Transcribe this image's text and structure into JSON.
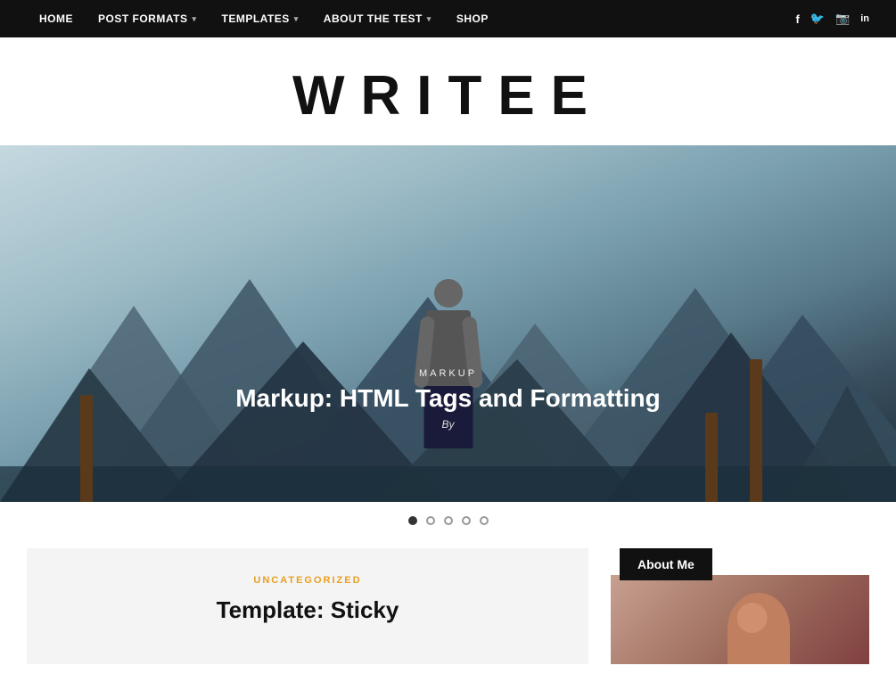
{
  "nav": {
    "links": [
      {
        "id": "home",
        "label": "HOME",
        "hasDropdown": false
      },
      {
        "id": "post-formats",
        "label": "POST FORMATS",
        "hasDropdown": true
      },
      {
        "id": "templates",
        "label": "TEMPLATES",
        "hasDropdown": true
      },
      {
        "id": "about-the-test",
        "label": "ABOUT THE TEST",
        "hasDropdown": true
      },
      {
        "id": "shop",
        "label": "SHOP",
        "hasDropdown": false
      }
    ],
    "social": [
      {
        "id": "facebook",
        "icon": "f",
        "symbol": "𝑓"
      },
      {
        "id": "twitter",
        "icon": "t"
      },
      {
        "id": "instagram",
        "icon": "📷"
      },
      {
        "id": "linkedin",
        "icon": "in"
      }
    ]
  },
  "site": {
    "title": "WRITEE"
  },
  "hero": {
    "category": "MARKUP",
    "title": "Markup: HTML Tags and Formatting",
    "by_label": "By",
    "dots": [
      {
        "id": 1,
        "active": true
      },
      {
        "id": 2,
        "active": false
      },
      {
        "id": 3,
        "active": false
      },
      {
        "id": 4,
        "active": false
      },
      {
        "id": 5,
        "active": false
      }
    ]
  },
  "blog_card": {
    "category": "UNCATEGORIZED",
    "title": "Template: Sticky"
  },
  "sidebar": {
    "about_me_label": "About Me"
  }
}
